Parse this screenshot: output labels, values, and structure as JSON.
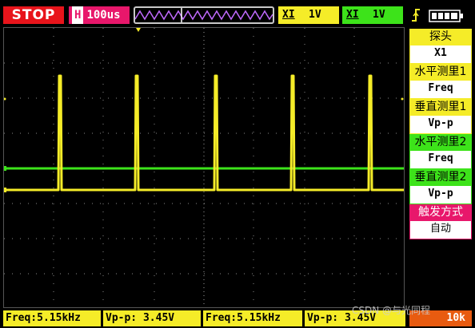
{
  "status": {
    "run_state": "STOP"
  },
  "timebase": {
    "prefix": "H",
    "value": "100us"
  },
  "channel1": {
    "coupling": "XI",
    "scale": "1V",
    "color": "#f5ec28"
  },
  "channel2": {
    "coupling": "XI",
    "scale": "1V",
    "color": "#3de31a"
  },
  "icons": {
    "trigger": "trigger-edge-icon",
    "battery": "battery-icon"
  },
  "side_menu": [
    {
      "header": "探头",
      "value": "X1"
    },
    {
      "header": "水平测里1",
      "value": "Freq"
    },
    {
      "header": "垂直测里1",
      "value": "Vp-p"
    },
    {
      "header": "水平测里2",
      "value": "Freq"
    },
    {
      "header": "垂直测里2",
      "value": "Vp-p"
    },
    {
      "header": "触发方式",
      "value": "自动"
    }
  ],
  "measurements": [
    {
      "text": "Freq:5.15kHz"
    },
    {
      "text": "Vp-p: 3.45V"
    },
    {
      "text": "Freq:5.15kHz"
    },
    {
      "text": "Vp-p: 3.45V"
    }
  ],
  "sample_rate": "10k",
  "watermark": "CSDN @与光同程"
}
